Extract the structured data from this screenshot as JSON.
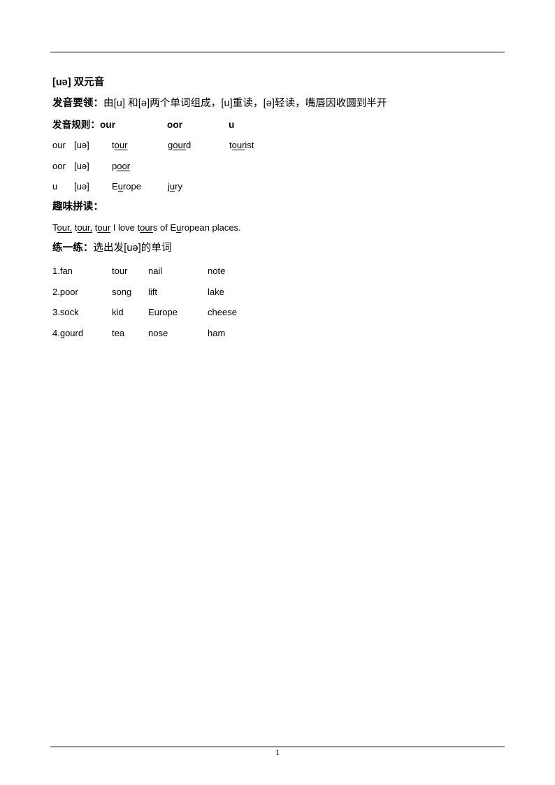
{
  "document": {
    "page_number": "1",
    "title": "[uə] 双元音",
    "sections": {
      "key_points": {
        "label": "发音要领：",
        "text": "由[u] 和[ə]两个单词组成，[u]重读，[ə]轻读，嘴唇因收圆到半开"
      },
      "rules": {
        "label": "发音规则：",
        "column_headers": [
          "our",
          "oor",
          "u"
        ],
        "rows": [
          {
            "spelling": "our",
            "ipa": "[uə]",
            "examples": [
              {
                "prefix": "t",
                "stress": "our",
                "suffix": ""
              },
              {
                "prefix": "g",
                "stress": "our",
                "suffix": "d"
              },
              {
                "prefix": "t",
                "stress": "our",
                "suffix": "ist"
              }
            ]
          },
          {
            "spelling": "oor",
            "ipa": "[uə]",
            "examples": [
              {
                "prefix": "p",
                "stress": "oor",
                "suffix": ""
              }
            ]
          },
          {
            "spelling": "u",
            "ipa": "[uə]",
            "examples": [
              {
                "prefix": "E",
                "stress": "u",
                "suffix": "rope"
              },
              {
                "prefix": "j",
                "stress": "u",
                "suffix": "ry"
              }
            ]
          }
        ]
      },
      "fun_reading": {
        "label": "趣味拼读：",
        "sentence_parts": [
          {
            "prefix": "T",
            "stress": "our,",
            "suffix": " "
          },
          {
            "prefix": "t",
            "stress": "our,",
            "suffix": " "
          },
          {
            "prefix": "t",
            "stress": "our",
            "suffix": " I love "
          },
          {
            "prefix": "t",
            "stress": "our",
            "suffix": "s of "
          },
          {
            "prefix": "E",
            "stress": "u",
            "suffix": "ropean places."
          }
        ]
      },
      "practice": {
        "label": "练一练：",
        "instruction": "选出发[uə]的单词",
        "rows": [
          [
            "1.fan",
            "tour",
            "nail",
            "note"
          ],
          [
            "2.poor",
            "song",
            "lift",
            "lake"
          ],
          [
            "3.sock",
            "kid",
            "Europe",
            "cheese"
          ],
          [
            "4.gourd",
            "tea",
            "nose",
            "ham"
          ]
        ]
      }
    }
  }
}
